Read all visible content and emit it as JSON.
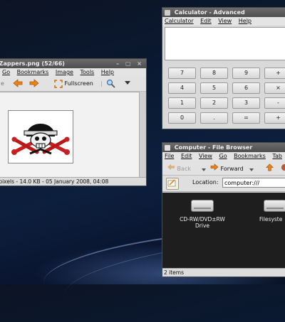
{
  "image_viewer": {
    "title": "zZappers.png (52/66)",
    "window_controls": "– ▢ ×",
    "menu": [
      "Go",
      "Bookmarks",
      "Image",
      "Tools",
      "Help"
    ],
    "toolbar": {
      "partial": "e",
      "fullscreen": "Fullscreen"
    },
    "status": "t pixels - 14.0 KB - 05 January 2008, 04:08"
  },
  "calculator": {
    "title": "Calculator - Advanced",
    "window_controls": "– ▢ ×",
    "menu": [
      "Calculator",
      "Edit",
      "View",
      "Help"
    ],
    "display_value": "",
    "keys": [
      [
        "7",
        "8",
        "9",
        "+"
      ],
      [
        "4",
        "5",
        "6",
        "×"
      ],
      [
        "1",
        "2",
        "3",
        "-"
      ],
      [
        "0",
        ".",
        "=",
        "+"
      ]
    ]
  },
  "file_browser": {
    "title": "Computer - File Browser",
    "menu": [
      "File",
      "Edit",
      "View",
      "Go",
      "Bookmarks",
      "Tab"
    ],
    "toolbar": {
      "back": "Back",
      "forward": "Forward"
    },
    "location_label": "Location:",
    "location_value": "computer:///",
    "items": [
      {
        "label": "CD-RW/DVD±RW Drive"
      },
      {
        "label": "Filesyste"
      }
    ],
    "status": "2 items"
  },
  "colors": {
    "titlebar": "#555555",
    "window_bg": "#d9d9d9",
    "accent_orange": "#e8841a",
    "icon_area": "#1e1e1e"
  }
}
